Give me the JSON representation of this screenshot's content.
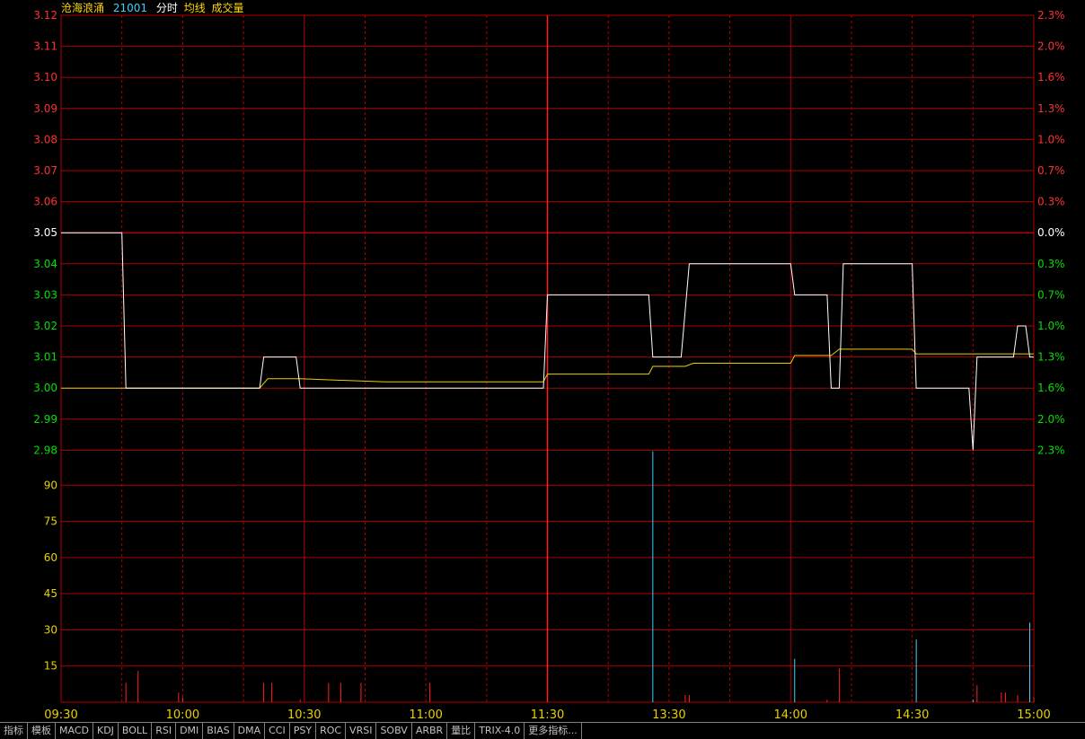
{
  "header": {
    "name": "沧海浪涌",
    "code": "21001",
    "labels": [
      "分时",
      "均线",
      "成交量"
    ]
  },
  "colors": {
    "grid": "#b00000",
    "price_up": "#ff3030",
    "price_base": "#ffffff",
    "price_down": "#00e000",
    "volume_axis": "#e8d000",
    "price_line": "#ffffff",
    "avg_line": "#e8d000",
    "vol_up": "#ff2020",
    "vol_down": "#40d0ff",
    "time_labels": "#e8d000",
    "name_color": "#ffd700",
    "code_color": "#40d0ff",
    "label_color": "#ffffff"
  },
  "tabs": [
    "指标",
    "模板",
    "MACD",
    "KDJ",
    "BOLL",
    "RSI",
    "DMI",
    "BIAS",
    "DMA",
    "CCI",
    "PSY",
    "ROC",
    "VRSI",
    "SOBV",
    "ARBR",
    "量比",
    "TRIX-4.0",
    "更多指标..."
  ],
  "chart_data": {
    "type": "line",
    "title": "",
    "price_axis": {
      "ticks": [
        "3.12",
        "3.11",
        "3.10",
        "3.09",
        "3.08",
        "3.07",
        "3.06",
        "3.05",
        "3.04",
        "3.03",
        "3.02",
        "3.01",
        "3.00",
        "2.99",
        "2.98"
      ],
      "ylim": [
        2.98,
        3.12
      ],
      "base": 3.05
    },
    "pct_axis": {
      "ticks": [
        "2.3%",
        "2.0%",
        "1.6%",
        "1.3%",
        "1.0%",
        "0.7%",
        "0.3%",
        "0.0%",
        "0.3%",
        "0.7%",
        "1.0%",
        "1.3%",
        "1.6%",
        "2.0%",
        "2.3%"
      ]
    },
    "volume_axis": {
      "ticks": [
        "90",
        "75",
        "60",
        "45",
        "30",
        "15"
      ],
      "ylim": [
        0,
        105
      ]
    },
    "time_axis": {
      "labels": [
        "09:30",
        "10:00",
        "10:30",
        "11:00",
        "11:30",
        "13:30",
        "14:00",
        "14:30",
        "15:00"
      ],
      "minutes_total": 240
    },
    "series": [
      {
        "name": "分时",
        "points": [
          [
            0,
            3.05
          ],
          [
            15,
            3.05
          ],
          [
            16,
            3.0
          ],
          [
            49,
            3.0
          ],
          [
            50,
            3.01
          ],
          [
            58,
            3.01
          ],
          [
            59,
            3.0
          ],
          [
            119,
            3.0
          ],
          [
            120,
            3.03
          ],
          [
            145,
            3.03
          ],
          [
            146,
            3.01
          ],
          [
            153,
            3.01
          ],
          [
            155,
            3.04
          ],
          [
            180,
            3.04
          ],
          [
            181,
            3.03
          ],
          [
            189,
            3.03
          ],
          [
            190,
            3.0
          ],
          [
            192,
            3.0
          ],
          [
            193,
            3.04
          ],
          [
            210,
            3.04
          ],
          [
            211,
            3.0
          ],
          [
            224,
            3.0
          ],
          [
            225,
            2.98
          ],
          [
            226,
            3.01
          ],
          [
            235,
            3.01
          ],
          [
            236,
            3.02
          ],
          [
            238,
            3.02
          ],
          [
            239,
            3.01
          ],
          [
            240,
            3.01
          ]
        ]
      },
      {
        "name": "均线",
        "points": [
          [
            0,
            3.0
          ],
          [
            49,
            3.0
          ],
          [
            51,
            3.003
          ],
          [
            53,
            3.003
          ],
          [
            59,
            3.003
          ],
          [
            80,
            3.002
          ],
          [
            119,
            3.002
          ],
          [
            120,
            3.0045
          ],
          [
            145,
            3.0045
          ],
          [
            146,
            3.007
          ],
          [
            154,
            3.007
          ],
          [
            156,
            3.008
          ],
          [
            180,
            3.008
          ],
          [
            181,
            3.0105
          ],
          [
            190,
            3.0105
          ],
          [
            192,
            3.0125
          ],
          [
            210,
            3.0125
          ],
          [
            211,
            3.011
          ],
          [
            240,
            3.011
          ]
        ]
      }
    ],
    "volume": [
      {
        "t": 16,
        "v": 8,
        "up": true
      },
      {
        "t": 19,
        "v": 13,
        "up": true
      },
      {
        "t": 29,
        "v": 4,
        "up": true
      },
      {
        "t": 30,
        "v": 2,
        "up": true
      },
      {
        "t": 50,
        "v": 8,
        "up": true
      },
      {
        "t": 52,
        "v": 8,
        "up": true
      },
      {
        "t": 59,
        "v": 1,
        "up": true
      },
      {
        "t": 66,
        "v": 8,
        "up": true
      },
      {
        "t": 69,
        "v": 8,
        "up": true
      },
      {
        "t": 74,
        "v": 8,
        "up": true
      },
      {
        "t": 91,
        "v": 8,
        "up": true
      },
      {
        "t": 120,
        "v": 8,
        "up": true
      },
      {
        "t": 146,
        "v": 104,
        "up": false
      },
      {
        "t": 154,
        "v": 3,
        "up": true
      },
      {
        "t": 155,
        "v": 3,
        "up": true
      },
      {
        "t": 181,
        "v": 18,
        "up": false
      },
      {
        "t": 189,
        "v": 1,
        "up": true
      },
      {
        "t": 192,
        "v": 14,
        "up": true
      },
      {
        "t": 211,
        "v": 26,
        "up": false
      },
      {
        "t": 225,
        "v": 1,
        "up": false
      },
      {
        "t": 226,
        "v": 7,
        "up": true
      },
      {
        "t": 232,
        "v": 4,
        "up": true
      },
      {
        "t": 233,
        "v": 4,
        "up": true
      },
      {
        "t": 236,
        "v": 3,
        "up": true
      },
      {
        "t": 239,
        "v": 33,
        "up": false
      },
      {
        "t": 240,
        "v": 2,
        "up": true
      }
    ]
  }
}
